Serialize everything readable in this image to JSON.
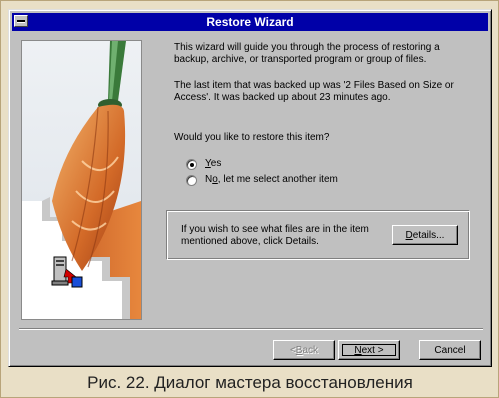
{
  "window": {
    "title": "Restore Wizard"
  },
  "content": {
    "intro": "This wizard will guide you through the process of restoring a backup, archive, or transported program or group of files.",
    "last_item": "The last item that was backed up was '2 Files Based on Size or Access'.  It was backed up about 23 minutes ago.",
    "question": "Would you like to restore this item?",
    "options": [
      {
        "label_prefix": "",
        "label_underlined": "Y",
        "label_rest": "es",
        "selected": true
      },
      {
        "label_prefix": "N",
        "label_underlined": "o",
        "label_rest": ", let me select another item",
        "selected": false
      }
    ],
    "details_text": "If you wish to see what files are in the item mentioned above, click Details.",
    "details_button": {
      "underlined": "D",
      "rest": "etails..."
    }
  },
  "buttons": {
    "back": {
      "prefix": "< ",
      "underlined": "B",
      "rest": "ack"
    },
    "next": {
      "underlined": "N",
      "rest": "ext >"
    },
    "cancel": "Cancel"
  },
  "caption": "Рис. 22. Диалог мастера восстановления",
  "colors": {
    "titlebar": "#0000a8",
    "dialog_face": "#c0c0c0",
    "page_background": "#e9dfc6"
  },
  "icons": [
    "system-menu-icon",
    "broom-illustration",
    "computer-restore-icon"
  ]
}
